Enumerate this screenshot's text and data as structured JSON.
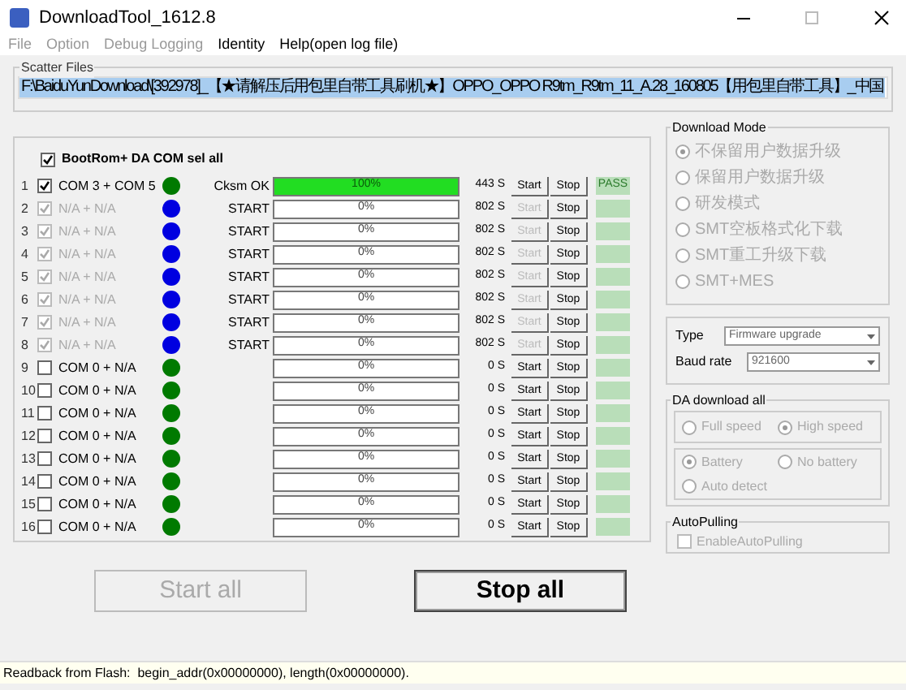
{
  "window": {
    "title": "DownloadTool_1612.8"
  },
  "menu": [
    {
      "label": "File",
      "disabled": true
    },
    {
      "label": "Option",
      "disabled": true
    },
    {
      "label": "Debug Logging",
      "disabled": true
    },
    {
      "label": "Identity",
      "disabled": false
    },
    {
      "label": "Help(open log file)",
      "disabled": false
    }
  ],
  "scatter": {
    "title": "Scatter Files",
    "path": "F:\\BaiduYunDownload\\[392978]_【★请解压后用包里自带工具刷机★】OPPO_OPPO R9tm_R9tm_11_A.28_160805【用包里自带工具】_中国"
  },
  "select_all": {
    "label": "BootRom+ DA COM sel all",
    "checked": true
  },
  "ports": [
    {
      "index": "1",
      "label": "COM 3 + COM 5",
      "checked": true,
      "disabled": false,
      "color": "#007a00",
      "status": "Cksm OK",
      "level": 1,
      "progress": "100%",
      "time": "443 S",
      "start_label": "Start",
      "start_disabled": false,
      "stop_label": "Stop",
      "result": "PASS"
    },
    {
      "index": "2",
      "label": "N/A + N/A",
      "checked": true,
      "disabled": true,
      "color": "#0000e0",
      "status": "START",
      "level": 0,
      "progress": "0%",
      "time": "802 S",
      "start_label": "Start",
      "start_disabled": true,
      "stop_label": "Stop"
    },
    {
      "index": "3",
      "label": "N/A + N/A",
      "checked": true,
      "disabled": true,
      "color": "#0000e0",
      "status": "START",
      "level": 0,
      "progress": "0%",
      "time": "802 S",
      "start_label": "Start",
      "start_disabled": true,
      "stop_label": "Stop"
    },
    {
      "index": "4",
      "label": "N/A + N/A",
      "checked": true,
      "disabled": true,
      "color": "#0000e0",
      "status": "START",
      "level": 0,
      "progress": "0%",
      "time": "802 S",
      "start_label": "Start",
      "start_disabled": true,
      "stop_label": "Stop"
    },
    {
      "index": "5",
      "label": "N/A + N/A",
      "checked": true,
      "disabled": true,
      "color": "#0000e0",
      "status": "START",
      "level": 0,
      "progress": "0%",
      "time": "802 S",
      "start_label": "Start",
      "start_disabled": true,
      "stop_label": "Stop"
    },
    {
      "index": "6",
      "label": "N/A + N/A",
      "checked": true,
      "disabled": true,
      "color": "#0000e0",
      "status": "START",
      "level": 0,
      "progress": "0%",
      "time": "802 S",
      "start_label": "Start",
      "start_disabled": true,
      "stop_label": "Stop"
    },
    {
      "index": "7",
      "label": "N/A + N/A",
      "checked": true,
      "disabled": true,
      "color": "#0000e0",
      "status": "START",
      "level": 0,
      "progress": "0%",
      "time": "802 S",
      "start_label": "Start",
      "start_disabled": true,
      "stop_label": "Stop"
    },
    {
      "index": "8",
      "label": "N/A + N/A",
      "checked": true,
      "disabled": true,
      "color": "#0000e0",
      "status": "START",
      "level": 0,
      "progress": "0%",
      "time": "802 S",
      "start_label": "Start",
      "start_disabled": true,
      "stop_label": "Stop"
    },
    {
      "index": "9",
      "label": "COM 0 + N/A",
      "checked": false,
      "disabled": false,
      "color": "#007a00",
      "level": 0,
      "progress": "0%",
      "time": "0 S",
      "start_label": "Start",
      "start_disabled": false,
      "stop_label": "Stop"
    },
    {
      "index": "10",
      "label": "COM 0 + N/A",
      "checked": false,
      "disabled": false,
      "color": "#007a00",
      "level": 0,
      "progress": "0%",
      "time": "0 S",
      "start_label": "Start",
      "start_disabled": false,
      "stop_label": "Stop"
    },
    {
      "index": "11",
      "label": "COM 0 + N/A",
      "checked": false,
      "disabled": false,
      "color": "#007a00",
      "level": 0,
      "progress": "0%",
      "time": "0 S",
      "start_label": "Start",
      "start_disabled": false,
      "stop_label": "Stop"
    },
    {
      "index": "12",
      "label": "COM 0 + N/A",
      "checked": false,
      "disabled": false,
      "color": "#007a00",
      "level": 0,
      "progress": "0%",
      "time": "0 S",
      "start_label": "Start",
      "start_disabled": false,
      "stop_label": "Stop"
    },
    {
      "index": "13",
      "label": "COM 0 + N/A",
      "checked": false,
      "disabled": false,
      "color": "#007a00",
      "level": 0,
      "progress": "0%",
      "time": "0 S",
      "start_label": "Start",
      "start_disabled": false,
      "stop_label": "Stop"
    },
    {
      "index": "14",
      "label": "COM 0 + N/A",
      "checked": false,
      "disabled": false,
      "color": "#007a00",
      "level": 0,
      "progress": "0%",
      "time": "0 S",
      "start_label": "Start",
      "start_disabled": false,
      "stop_label": "Stop"
    },
    {
      "index": "15",
      "label": "COM 0 + N/A",
      "checked": false,
      "disabled": false,
      "color": "#007a00",
      "level": 0,
      "progress": "0%",
      "time": "0 S",
      "start_label": "Start",
      "start_disabled": false,
      "stop_label": "Stop"
    },
    {
      "index": "16",
      "label": "COM 0 + N/A",
      "checked": false,
      "disabled": false,
      "color": "#007a00",
      "level": 0,
      "progress": "0%",
      "time": "0 S",
      "start_label": "Start",
      "start_disabled": false,
      "stop_label": "Stop"
    }
  ],
  "download_mode": {
    "title": "Download Mode",
    "options": [
      {
        "label": "不保留用户数据升级",
        "selected": true
      },
      {
        "label": "保留用户数据升级",
        "selected": false
      },
      {
        "label": "研发模式",
        "selected": false
      },
      {
        "label": "SMT空板格式化下载",
        "selected": false
      },
      {
        "label": "SMT重工升级下载",
        "selected": false
      },
      {
        "label": "SMT+MES",
        "selected": false
      }
    ]
  },
  "settings": [
    {
      "label": "Type",
      "value": "Firmware upgrade"
    },
    {
      "label": "Baud rate",
      "value": "921600"
    }
  ],
  "da_download": {
    "title": "DA download all",
    "speed": [
      {
        "label": "Full speed",
        "selected": false
      },
      {
        "label": "High speed",
        "selected": true
      }
    ],
    "power": [
      {
        "label": "Battery",
        "selected": true
      },
      {
        "label": "No battery",
        "selected": false
      },
      {
        "label": "Auto detect",
        "selected": false
      }
    ]
  },
  "autopulling": {
    "title": "AutoPulling",
    "label": "EnableAutoPulling",
    "checked": false
  },
  "buttons": [
    {
      "label": "Start all",
      "disabled": true
    },
    {
      "label": "Stop all",
      "disabled": false
    }
  ],
  "status_bar": "Readback from Flash:  begin_addr(0x00000000), length(0x00000000)."
}
